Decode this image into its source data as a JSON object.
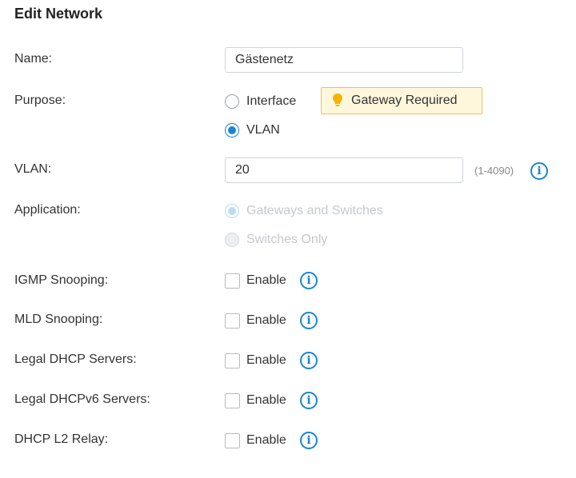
{
  "title": "Edit Network",
  "name": {
    "label": "Name:",
    "value": "Gästenetz"
  },
  "purpose": {
    "label": "Purpose:",
    "options": [
      {
        "label": "Interface",
        "checked": false
      },
      {
        "label": "VLAN",
        "checked": true
      }
    ],
    "tag": "Gateway Required"
  },
  "vlan": {
    "label": "VLAN:",
    "value": "20",
    "range": "(1-4090)"
  },
  "application": {
    "label": "Application:",
    "options": [
      {
        "label": "Gateways and Switches",
        "checked": true,
        "disabled": true
      },
      {
        "label": "Switches Only",
        "checked": false,
        "disabled": true
      }
    ]
  },
  "toggles": [
    {
      "label": "IGMP Snooping:",
      "option": "Enable",
      "checked": false
    },
    {
      "label": "MLD Snooping:",
      "option": "Enable",
      "checked": false
    },
    {
      "label": "Legal DHCP Servers:",
      "option": "Enable",
      "checked": false
    },
    {
      "label": "Legal DHCPv6 Servers:",
      "option": "Enable",
      "checked": false
    },
    {
      "label": "DHCP L2 Relay:",
      "option": "Enable",
      "checked": false
    }
  ],
  "icons": {
    "info": "info-icon",
    "bulb": "lightbulb-icon"
  },
  "colors": {
    "accent": "#1a86d0",
    "tag_border": "#f2c14e",
    "tag_bg": "#fff7dc"
  }
}
